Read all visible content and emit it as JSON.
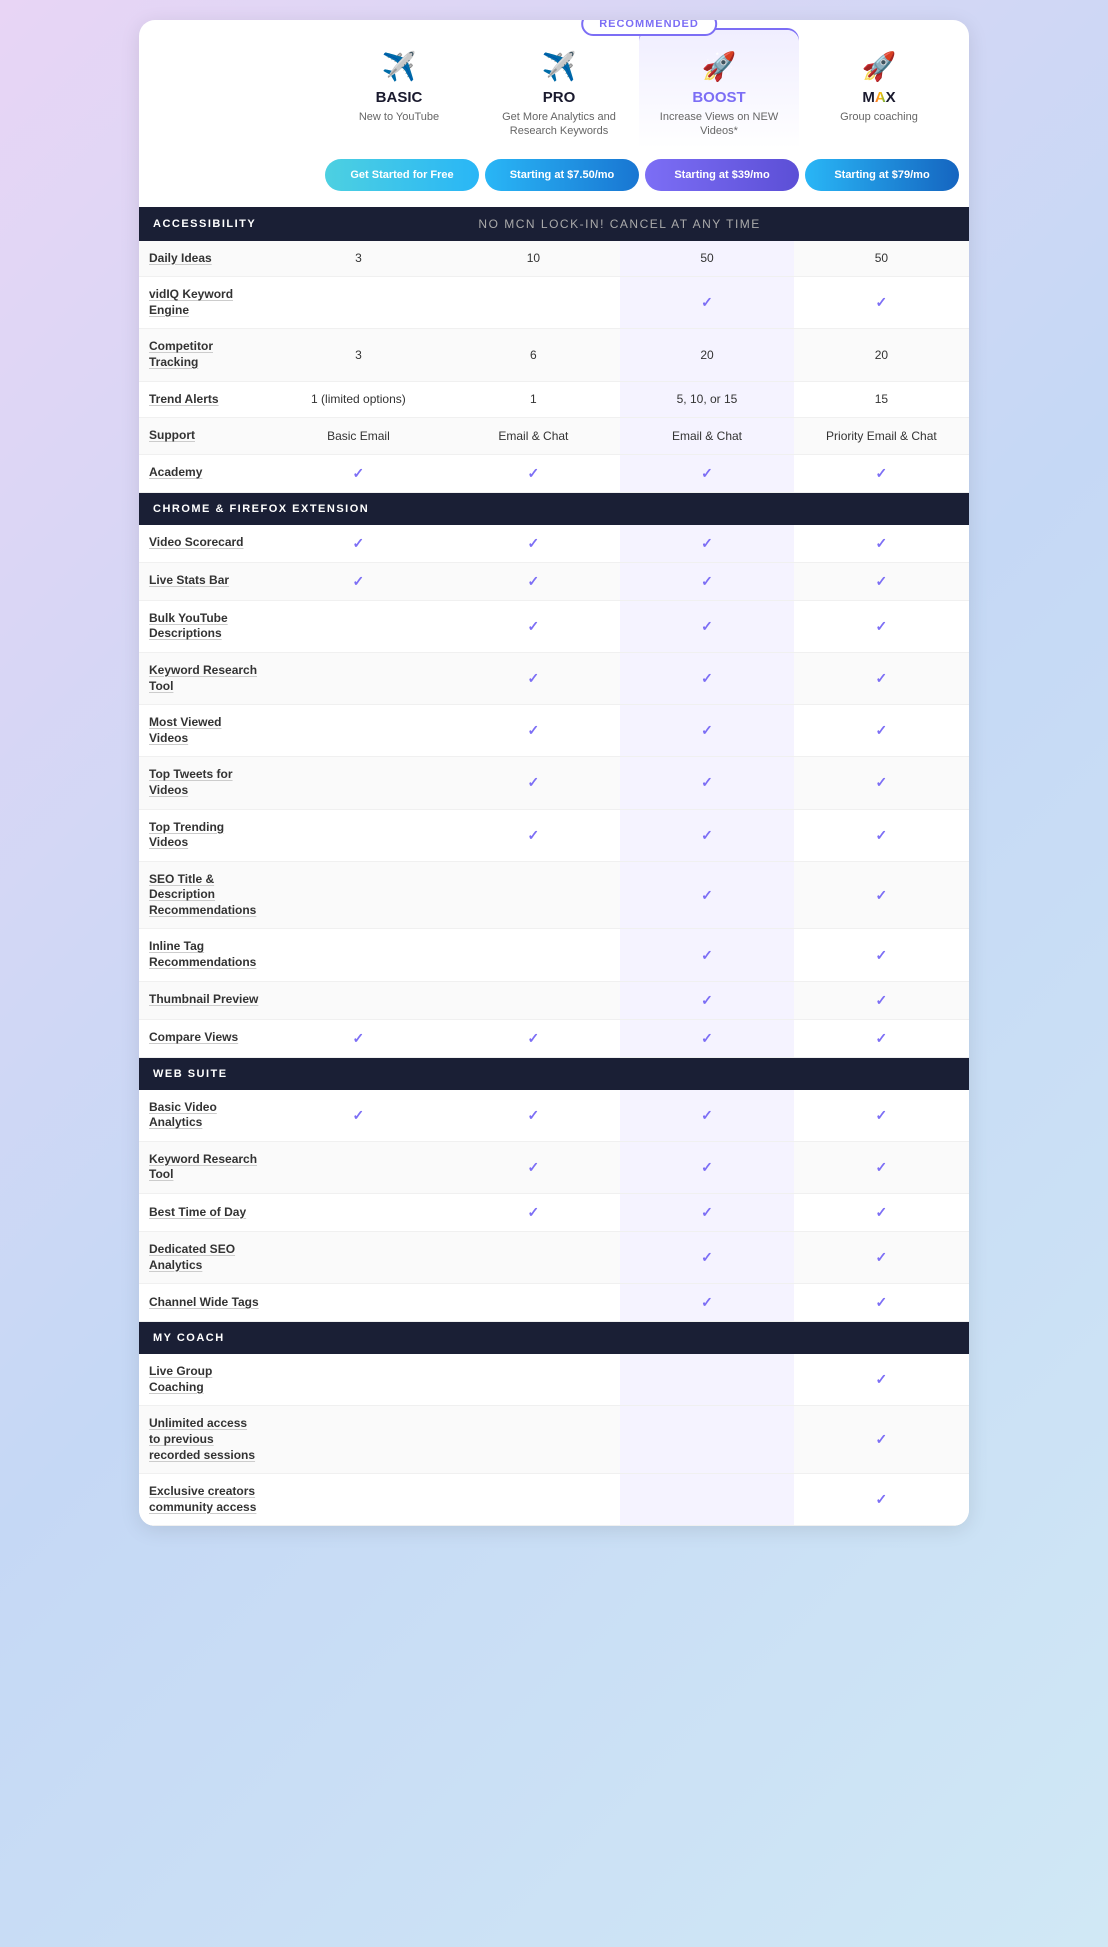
{
  "recommended_badge": "RECOMMENDED",
  "plans": [
    {
      "id": "basic",
      "icon": "✈",
      "name": "BASIC",
      "desc": "New to YouTube",
      "btn_label": "Get Started for Free",
      "btn_class": "btn-free"
    },
    {
      "id": "pro",
      "icon": "✈",
      "name": "PRO",
      "desc": "Get More Analytics and Research Keywords",
      "btn_label": "Starting at $7.50/mo",
      "btn_class": "btn-pro"
    },
    {
      "id": "boost",
      "icon": "🚀",
      "name": "BOOST",
      "desc": "Increase Views on NEW Videos*",
      "btn_label": "Starting at $39/mo",
      "btn_class": "btn-boost"
    },
    {
      "id": "max",
      "icon": "🚀",
      "name": "MAX",
      "desc": "Group coaching",
      "btn_label": "Starting at $79/mo",
      "btn_class": "btn-max"
    }
  ],
  "sections": [
    {
      "name": "ACCESSIBILITY",
      "note": "No MCN lock-in! Cancel at any time",
      "rows": [
        {
          "feature": "Daily Ideas",
          "basic": "3",
          "pro": "10",
          "boost": "50",
          "max": "50"
        },
        {
          "feature": "vidIQ Keyword Engine",
          "basic": "",
          "pro": "",
          "boost": "✓",
          "max": "✓"
        },
        {
          "feature": "Competitor Tracking",
          "basic": "3",
          "pro": "6",
          "boost": "20",
          "max": "20"
        },
        {
          "feature": "Trend Alerts",
          "basic": "1 (limited options)",
          "pro": "1",
          "boost": "5, 10, or 15",
          "max": "15"
        },
        {
          "feature": "Support",
          "basic": "Basic Email",
          "pro": "Email & Chat",
          "boost": "Email & Chat",
          "max": "Priority Email & Chat"
        },
        {
          "feature": "Academy",
          "basic": "✓",
          "pro": "✓",
          "boost": "✓",
          "max": "✓"
        }
      ]
    },
    {
      "name": "CHROME & FIREFOX EXTENSION",
      "note": "",
      "rows": [
        {
          "feature": "Video Scorecard",
          "basic": "✓",
          "pro": "✓",
          "boost": "✓",
          "max": "✓"
        },
        {
          "feature": "Live Stats Bar",
          "basic": "✓",
          "pro": "✓",
          "boost": "✓",
          "max": "✓"
        },
        {
          "feature": "Bulk YouTube Descriptions",
          "basic": "",
          "pro": "✓",
          "boost": "✓",
          "max": "✓"
        },
        {
          "feature": "Keyword Research Tool",
          "basic": "",
          "pro": "✓",
          "boost": "✓",
          "max": "✓"
        },
        {
          "feature": "Most Viewed Videos",
          "basic": "",
          "pro": "✓",
          "boost": "✓",
          "max": "✓"
        },
        {
          "feature": "Top Tweets for Videos",
          "basic": "",
          "pro": "✓",
          "boost": "✓",
          "max": "✓"
        },
        {
          "feature": "Top Trending Videos",
          "basic": "",
          "pro": "✓",
          "boost": "✓",
          "max": "✓"
        },
        {
          "feature": "SEO Title & Description Recommendations",
          "basic": "",
          "pro": "",
          "boost": "✓",
          "max": "✓"
        },
        {
          "feature": "Inline Tag Recommendations",
          "basic": "",
          "pro": "",
          "boost": "✓",
          "max": "✓"
        },
        {
          "feature": "Thumbnail Preview",
          "basic": "",
          "pro": "",
          "boost": "✓",
          "max": "✓"
        },
        {
          "feature": "Compare Views",
          "basic": "✓",
          "pro": "✓",
          "boost": "✓",
          "max": "✓"
        }
      ]
    },
    {
      "name": "WEB SUITE",
      "note": "",
      "rows": [
        {
          "feature": "Basic Video Analytics",
          "basic": "✓",
          "pro": "✓",
          "boost": "✓",
          "max": "✓"
        },
        {
          "feature": "Keyword Research Tool",
          "basic": "",
          "pro": "✓",
          "boost": "✓",
          "max": "✓"
        },
        {
          "feature": "Best Time of Day",
          "basic": "",
          "pro": "✓",
          "boost": "✓",
          "max": "✓"
        },
        {
          "feature": "Dedicated SEO Analytics",
          "basic": "",
          "pro": "",
          "boost": "✓",
          "max": "✓"
        },
        {
          "feature": "Channel Wide Tags",
          "basic": "",
          "pro": "",
          "boost": "✓",
          "max": "✓"
        }
      ]
    },
    {
      "name": "MY COACH",
      "note": "",
      "rows": [
        {
          "feature": "Live Group Coaching",
          "basic": "",
          "pro": "",
          "boost": "",
          "max": "✓"
        },
        {
          "feature": "Unlimited access to previous recorded sessions",
          "basic": "",
          "pro": "",
          "boost": "",
          "max": "✓"
        },
        {
          "feature": "Exclusive creators community access",
          "basic": "",
          "pro": "",
          "boost": "",
          "max": "✓"
        }
      ]
    }
  ]
}
